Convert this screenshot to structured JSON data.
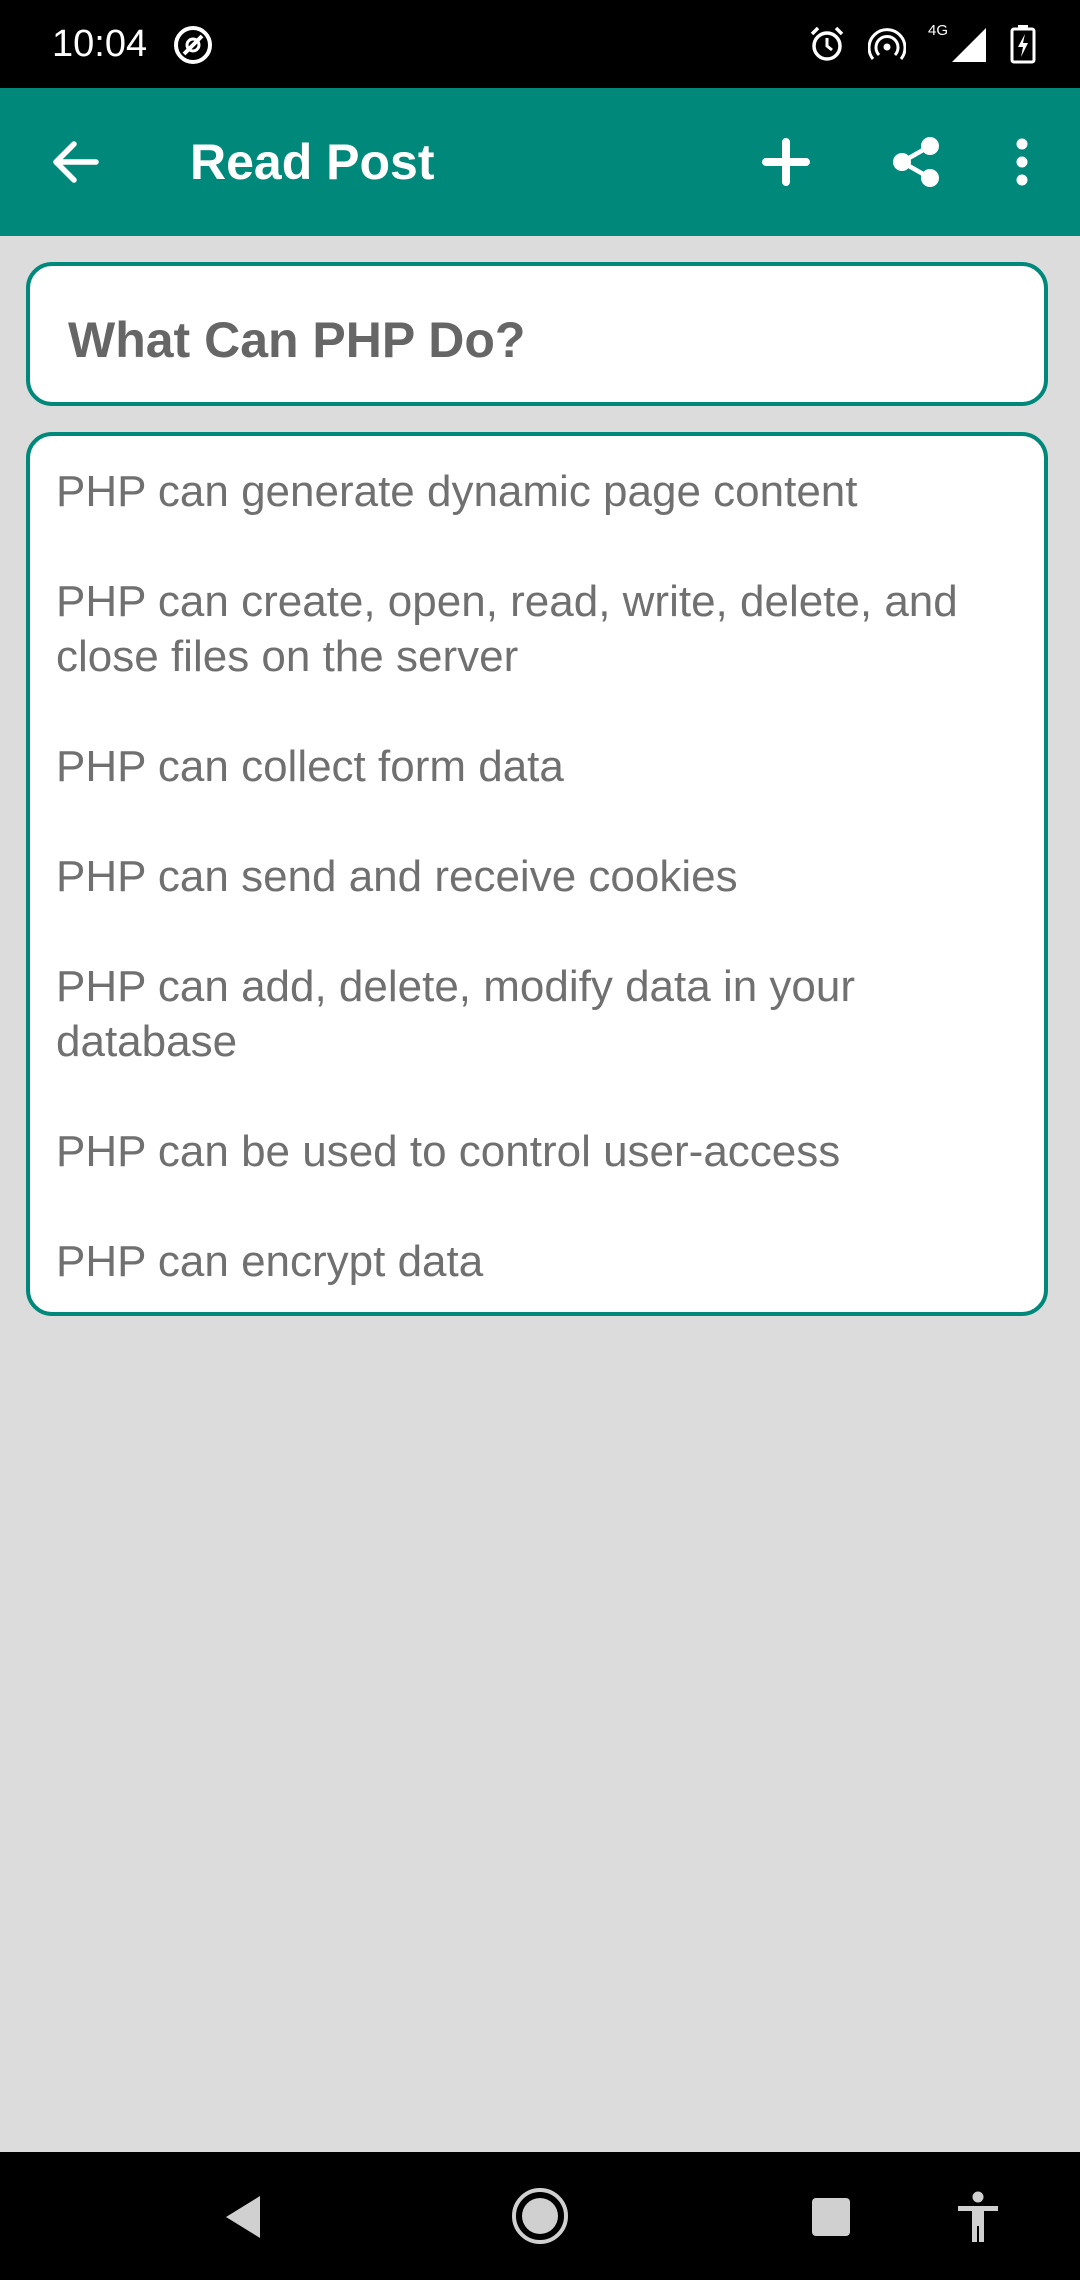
{
  "status_bar": {
    "time": "10:04",
    "network_label": "4G"
  },
  "app_bar": {
    "title": "Read Post",
    "accent_color": "#00897b"
  },
  "post": {
    "title": "What Can PHP Do?",
    "paragraphs": [
      "PHP can generate dynamic page content",
      "PHP can create, open, read, write, delete, and close files on the server",
      "PHP can collect form data",
      "PHP can send and receive cookies",
      "PHP can add, delete, modify data in your database",
      "PHP can be used to control user-access",
      "PHP can encrypt data"
    ]
  },
  "icons": {
    "back": "arrow-left-icon",
    "add": "plus-icon",
    "share": "share-icon",
    "more": "more-vert-icon",
    "nav_back": "triangle-back-icon",
    "nav_home": "circle-home-icon",
    "nav_recents": "square-recents-icon",
    "accessibility": "accessibility-icon"
  }
}
